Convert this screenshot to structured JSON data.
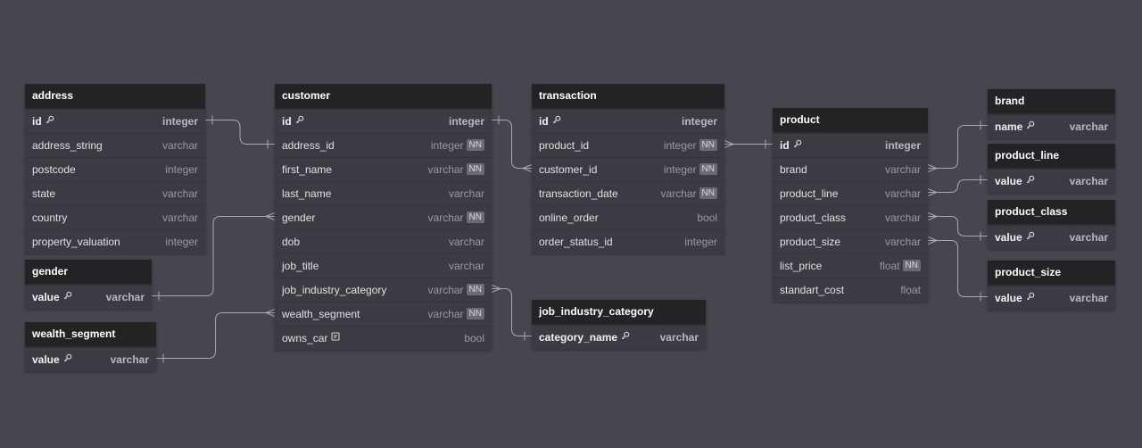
{
  "tables": {
    "address": {
      "title": "address",
      "columns": [
        {
          "name": "id",
          "type": "integer",
          "pk": true,
          "nn": false
        },
        {
          "name": "address_string",
          "type": "varchar",
          "pk": false,
          "nn": false
        },
        {
          "name": "postcode",
          "type": "integer",
          "pk": false,
          "nn": false
        },
        {
          "name": "state",
          "type": "varchar",
          "pk": false,
          "nn": false
        },
        {
          "name": "country",
          "type": "varchar",
          "pk": false,
          "nn": false
        },
        {
          "name": "property_valuation",
          "type": "integer",
          "pk": false,
          "nn": false
        }
      ]
    },
    "gender": {
      "title": "gender",
      "columns": [
        {
          "name": "value",
          "type": "varchar",
          "pk": true,
          "nn": false
        }
      ]
    },
    "wealth_segment": {
      "title": "wealth_segment",
      "columns": [
        {
          "name": "value",
          "type": "varchar",
          "pk": true,
          "nn": false
        }
      ]
    },
    "customer": {
      "title": "customer",
      "columns": [
        {
          "name": "id",
          "type": "integer",
          "pk": true,
          "nn": false
        },
        {
          "name": "address_id",
          "type": "integer",
          "pk": false,
          "nn": true
        },
        {
          "name": "first_name",
          "type": "varchar",
          "pk": false,
          "nn": true
        },
        {
          "name": "last_name",
          "type": "varchar",
          "pk": false,
          "nn": false
        },
        {
          "name": "gender",
          "type": "varchar",
          "pk": false,
          "nn": true
        },
        {
          "name": "dob",
          "type": "varchar",
          "pk": false,
          "nn": false
        },
        {
          "name": "job_title",
          "type": "varchar",
          "pk": false,
          "nn": false
        },
        {
          "name": "job_industry_category",
          "type": "varchar",
          "pk": false,
          "nn": true
        },
        {
          "name": "wealth_segment",
          "type": "varchar",
          "pk": false,
          "nn": true
        },
        {
          "name": "owns_car",
          "type": "bool",
          "pk": false,
          "nn": false,
          "note": true
        }
      ]
    },
    "transaction": {
      "title": "transaction",
      "columns": [
        {
          "name": "id",
          "type": "integer",
          "pk": true,
          "nn": false
        },
        {
          "name": "product_id",
          "type": "integer",
          "pk": false,
          "nn": true
        },
        {
          "name": "customer_id",
          "type": "integer",
          "pk": false,
          "nn": true
        },
        {
          "name": "transaction_date",
          "type": "varchar",
          "pk": false,
          "nn": true
        },
        {
          "name": "online_order",
          "type": "bool",
          "pk": false,
          "nn": false
        },
        {
          "name": "order_status_id",
          "type": "integer",
          "pk": false,
          "nn": false
        }
      ]
    },
    "job_industry_category": {
      "title": "job_industry_category",
      "columns": [
        {
          "name": "category_name",
          "type": "varchar",
          "pk": true,
          "nn": false
        }
      ]
    },
    "product": {
      "title": "product",
      "columns": [
        {
          "name": "id",
          "type": "integer",
          "pk": true,
          "nn": false
        },
        {
          "name": "brand",
          "type": "varchar",
          "pk": false,
          "nn": false
        },
        {
          "name": "product_line",
          "type": "varchar",
          "pk": false,
          "nn": false
        },
        {
          "name": "product_class",
          "type": "varchar",
          "pk": false,
          "nn": false
        },
        {
          "name": "product_size",
          "type": "varchar",
          "pk": false,
          "nn": false
        },
        {
          "name": "list_price",
          "type": "float",
          "pk": false,
          "nn": true
        },
        {
          "name": "standart_cost",
          "type": "float",
          "pk": false,
          "nn": false
        }
      ]
    },
    "brand": {
      "title": "brand",
      "columns": [
        {
          "name": "name",
          "type": "varchar",
          "pk": true,
          "nn": false
        }
      ]
    },
    "product_line": {
      "title": "product_line",
      "columns": [
        {
          "name": "value",
          "type": "varchar",
          "pk": true,
          "nn": false
        }
      ]
    },
    "product_class": {
      "title": "product_class",
      "columns": [
        {
          "name": "value",
          "type": "varchar",
          "pk": true,
          "nn": false
        }
      ]
    },
    "product_size": {
      "title": "product_size",
      "columns": [
        {
          "name": "value",
          "type": "varchar",
          "pk": true,
          "nn": false
        }
      ]
    }
  },
  "badges": {
    "not_null": "NN"
  },
  "icons": {
    "primary_key": "key-icon",
    "note": "note-icon"
  },
  "colors": {
    "background": "#46464f",
    "header": "#232326",
    "body": "#3b3b43",
    "edge": "#a8a8b0"
  },
  "relationships": [
    {
      "from": "customer.address_id",
      "to": "address.id"
    },
    {
      "from": "customer.gender",
      "to": "gender.value"
    },
    {
      "from": "customer.wealth_segment",
      "to": "wealth_segment.value"
    },
    {
      "from": "transaction.customer_id",
      "to": "customer.id"
    },
    {
      "from": "customer.job_industry_category",
      "to": "job_industry_category.category_name"
    },
    {
      "from": "transaction.product_id",
      "to": "product.id"
    },
    {
      "from": "product.brand",
      "to": "brand.name"
    },
    {
      "from": "product.product_line",
      "to": "product_line.value"
    },
    {
      "from": "product.product_class",
      "to": "product_class.value"
    },
    {
      "from": "product.product_size",
      "to": "product_size.value"
    }
  ]
}
